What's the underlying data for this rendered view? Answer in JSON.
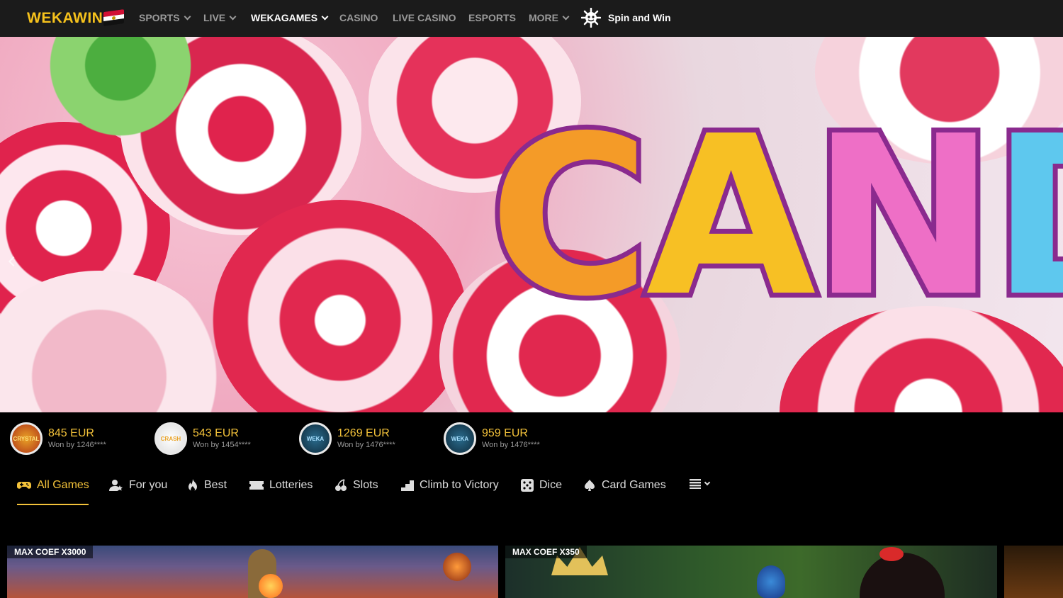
{
  "brand": {
    "logo_part1": "WEKA",
    "logo_part2": "WIN"
  },
  "nav": {
    "items": [
      {
        "label": "SPORTS",
        "has_dropdown": true
      },
      {
        "label": "LIVE",
        "has_dropdown": true
      },
      {
        "label": "WEKAGAMES",
        "has_dropdown": true,
        "active": true
      },
      {
        "label": "CASINO",
        "has_dropdown": false
      },
      {
        "label": "LIVE CASINO",
        "has_dropdown": false
      },
      {
        "label": "ESPORTS",
        "has_dropdown": false
      },
      {
        "label": "MORE",
        "has_dropdown": true
      }
    ],
    "spin_label": "Spin and Win"
  },
  "hero": {
    "title_letters": [
      "C",
      "A",
      "N",
      "D"
    ]
  },
  "winners": [
    {
      "amount": "845 EUR",
      "won_by": "Won by 1246****",
      "badge_text": "CRYSTAL"
    },
    {
      "amount": "543 EUR",
      "won_by": "Won by 1454****",
      "badge_text": "CRASH"
    },
    {
      "amount": "1269 EUR",
      "won_by": "Won by 1476****",
      "badge_text": "WEKA"
    },
    {
      "amount": "959 EUR",
      "won_by": "Won by 1476****",
      "badge_text": "WEKA"
    }
  ],
  "tabs": [
    {
      "label": "All Games",
      "icon": "gamepad-icon",
      "active": true
    },
    {
      "label": "For you",
      "icon": "user-star-icon"
    },
    {
      "label": "Best",
      "icon": "flame-icon"
    },
    {
      "label": "Lotteries",
      "icon": "ticket-icon"
    },
    {
      "label": "Slots",
      "icon": "cherries-icon"
    },
    {
      "label": "Climb to Victory",
      "icon": "stairs-icon"
    },
    {
      "label": "Dice",
      "icon": "dice-icon"
    },
    {
      "label": "Card Games",
      "icon": "spade-icon"
    }
  ],
  "games": [
    {
      "coef": "MAX COEF X3000"
    },
    {
      "coef": "MAX COEF X350"
    }
  ],
  "colors": {
    "accent": "#f3c23a",
    "nav_bg": "#1b1b1b",
    "page_bg": "#000000"
  }
}
